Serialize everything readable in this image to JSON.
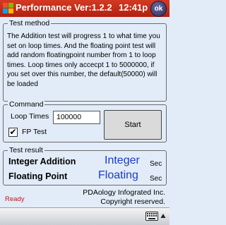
{
  "titlebar": {
    "title": "Performance Ver:1.2.2",
    "clock": "12:41p",
    "ok_label": "ok"
  },
  "test_method": {
    "legend": "Test method",
    "description": "The Addition test will progress 1 to what time you set on loop times. And the floating point test will add random floatingpoint number from 1 to loop times. Loop times only accecpt 1 to 5000000, if you set over this number, the default(50000) will be loaded"
  },
  "command": {
    "legend": "Command",
    "loop_label": "Loop Times",
    "loop_value": "100000",
    "fp_label": "FP Test",
    "fp_checked": true,
    "fp_check_mark": "✔",
    "start_label": "Start"
  },
  "result": {
    "legend": "Test result",
    "integer_label": "Integer Addition",
    "integer_value": "Integer",
    "integer_unit": "Sec",
    "floating_label": "Floating Point",
    "floating_value": "Floating",
    "floating_unit": "Sec"
  },
  "footer": {
    "company": "PDAology Infograted Inc.",
    "copyright": "Copyright reserved.",
    "status": "Ready"
  },
  "icons": {
    "start": "windows-flag-icon",
    "keyboard": "keyboard-icon",
    "arrow": "triangle-up-icon"
  },
  "colors": {
    "titlebar": "#c42b17",
    "background": "#e2ecf8",
    "result_value": "#1c3bc4",
    "status": "#c41414"
  }
}
